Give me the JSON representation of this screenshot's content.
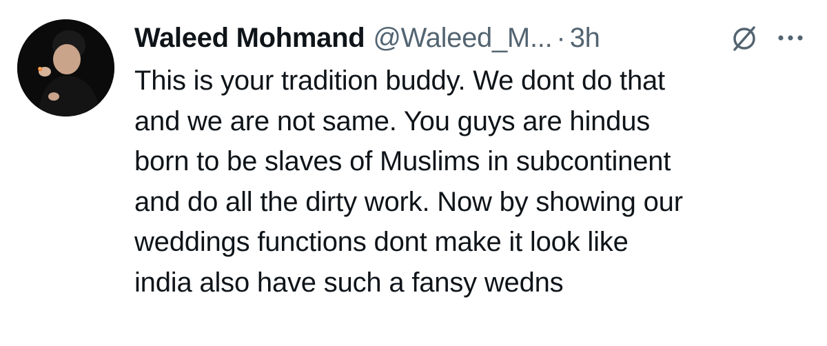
{
  "tweet": {
    "author": {
      "display_name": "Waleed Mohmand",
      "handle": "@Waleed_M...",
      "avatar_icon": "avatar-photo"
    },
    "separator": "·",
    "time": "3h",
    "actions": {
      "grok_icon": "grok-slash-icon",
      "more_icon": "more-dots-icon"
    },
    "text_lines": [
      "This is your tradition buddy. We dont do that",
      "and we are not same. You guys are hindus",
      "born to be slaves of Muslims in subcontinent",
      "and do all the dirty work. Now by showing our",
      "weddings functions dont make it look like",
      "india also have such a fansy wedns"
    ]
  },
  "colors": {
    "primary_text": "#0f1419",
    "secondary_text": "#536471",
    "background": "#ffffff"
  }
}
